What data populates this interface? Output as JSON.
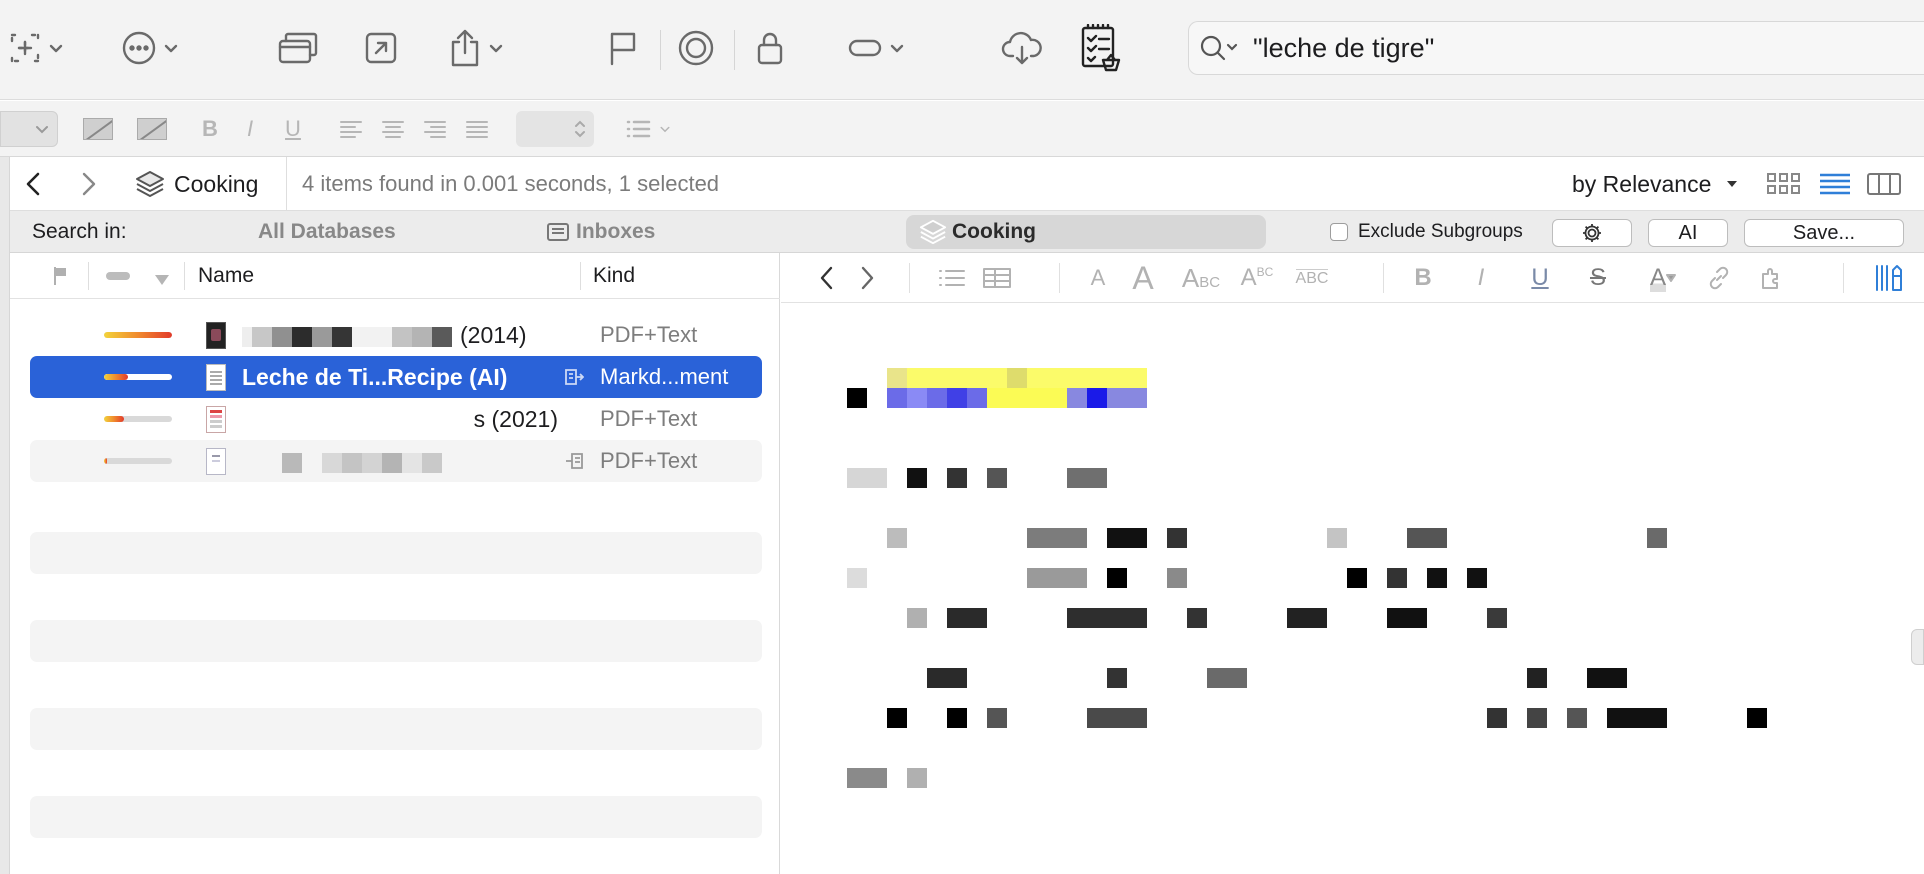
{
  "toolbar": {
    "search_query": "\"leche de tigre\"",
    "icons": [
      "new-group-icon",
      "more-actions-icon",
      "window-icon",
      "open-externally-icon",
      "share-icon",
      "flag-icon",
      "target-icon",
      "lock-icon",
      "tag-pill-icon",
      "cloud-sync-icon",
      "checklist-basket-icon",
      "search-icon"
    ]
  },
  "pathbar": {
    "database": "Cooking",
    "status": "4 items found in 0.001 seconds, 1 selected",
    "sort": "by Relevance"
  },
  "scope": {
    "search_in_label": "Search in:",
    "all_databases": "All Databases",
    "inboxes": "Inboxes",
    "cooking": "Cooking",
    "exclude_subgroups": "Exclude Subgroups",
    "ai_button": "AI",
    "save_button": "Save..."
  },
  "list": {
    "col_name": "Name",
    "col_kind": "Kind",
    "items": [
      {
        "name_visible": "(2014)",
        "kind": "PDF+Text",
        "relevance": 1.0,
        "selected": false
      },
      {
        "name_visible": "Leche de Ti...Recipe (AI)",
        "kind": "Markd...ment",
        "relevance": 0.35,
        "selected": true
      },
      {
        "name_visible": "s (2021)",
        "kind": "PDF+Text",
        "relevance": 0.3,
        "selected": false
      },
      {
        "name_visible": "",
        "kind": "PDF+Text",
        "relevance": 0.05,
        "selected": false
      }
    ]
  },
  "colors": {
    "selection": "#2a62d8",
    "relevance_high": "#e23a2a",
    "relevance_low": "#f3d33a",
    "accent_blue": "#2f7fd8"
  }
}
